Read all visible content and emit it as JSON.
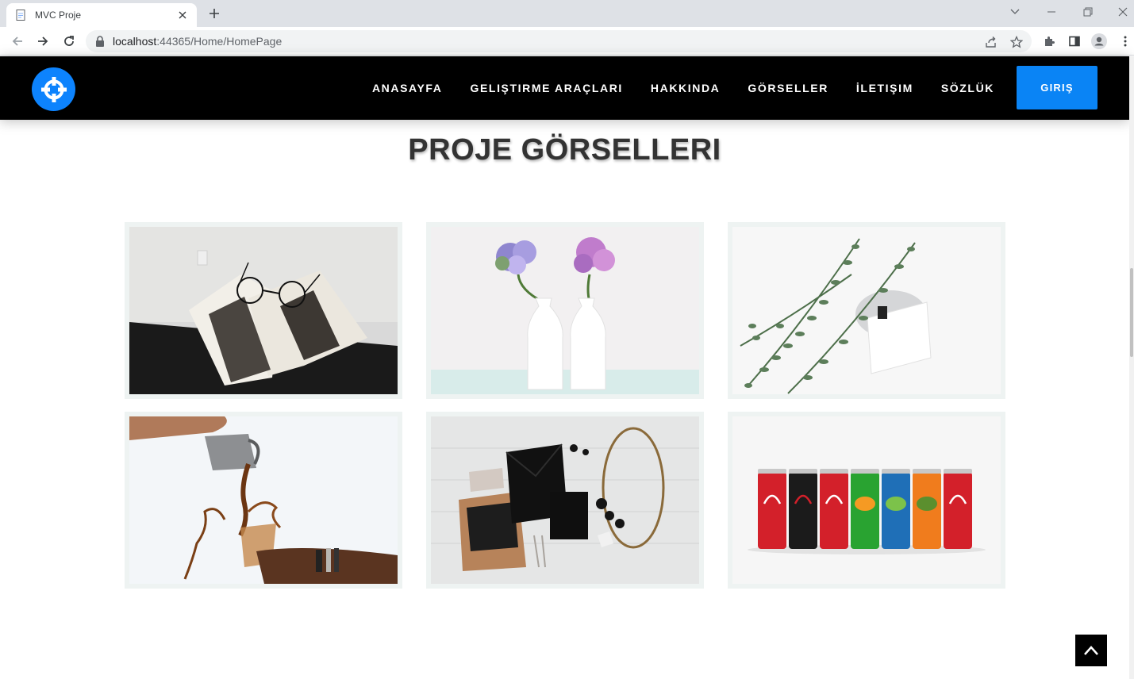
{
  "browser": {
    "tab_title": "MVC Proje",
    "url_host": "localhost",
    "url_rest": ":44365/Home/HomePage"
  },
  "header": {
    "menu": [
      "ANASAYFA",
      "GELIŞTIRME ARAÇLARI",
      "HAKKINDA",
      "GÖRSELLER",
      "İLETIŞIM",
      "SÖZLÜK"
    ],
    "login_label": "GIRIŞ",
    "accent_color": "#0d83fd"
  },
  "gallery": {
    "title": "PROJE GÖRSELLERI",
    "images": [
      "book-with-glasses",
      "hydrangeas-in-white-vases",
      "eucalyptus-and-note-card",
      "pouring-coffee-splash",
      "stationery-and-necklace",
      "soda-cans-row"
    ]
  },
  "icons": {
    "back_to_top": "chevron-up-icon",
    "logo": "crosshair-icon"
  }
}
